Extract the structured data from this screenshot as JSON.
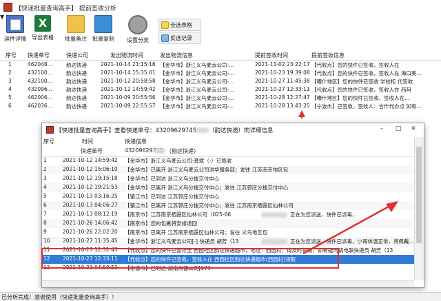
{
  "window": {
    "title": "【快递批量查询高手】 提前签收分析"
  },
  "toolbar": {
    "buttons": [
      {
        "label": "运件详情",
        "icon": "clipboard-icon"
      },
      {
        "label": "导出表格",
        "icon": "excel-icon"
      },
      {
        "label": "批量备注",
        "icon": "folder-icon"
      },
      {
        "label": "批量复制",
        "icon": "stack-icon"
      },
      {
        "label": "设置分类",
        "icon": "gear-icon"
      }
    ],
    "select_all": "全选表格",
    "invert_select": "反选记录"
  },
  "main_table": {
    "headers": [
      "序号",
      "快递单号",
      "快递公司",
      "发出物流时间",
      "发出物流信息",
      "提前签收时间",
      "提前签收信息"
    ],
    "rows": [
      [
        "1",
        "462048...",
        "韵达快递",
        "2021-10-14 21:15:16",
        "【金华市】浙江义乌麦云公司-...",
        "2021-11-02 23:22:17",
        "【代收点】您的快件已签收，签收人在"
      ],
      [
        "2",
        "432100...",
        "韵达快递",
        "2021-10-14 15:35:01",
        "【金华市】浙江义乌麦云公司-...",
        "2021-10-23 19:39:08",
        "【代收点】您的快件已签收，签收人在 海口美..."
      ],
      [
        "3",
        "432100...",
        "韵达快递",
        "2021-10-12 20:58:58",
        "【金华市】浙江义乌麦云公司-...",
        "2021-10-27 11:45:38",
        "【嘈什地区】您的快件已签收 学校柜 代签收"
      ],
      [
        "4",
        "432096...",
        "韵达快递",
        "2021-10-12 14:59:42",
        "【金华市】浙江义乌麦云公司-...",
        "2021-10-27 12:33:11",
        "【代收点】您的快件已签收，签收人在 西阿"
      ],
      [
        "5",
        "462006...",
        "韵达快递",
        "2021-10-09 20:55:56",
        "【金华市】浙江义乌麦云公司-...",
        "2021-10-28 12:27:47",
        "【嘈什地区】您的快件已签收，签收人在..."
      ],
      [
        "6",
        "462036...",
        "韵达快递",
        "2021-10-09 22:55:57",
        "【金华市】浙江义乌麦云公司-...",
        "2021-10-28 13:43:25",
        "【宁波市】已签收，签收人：合作代办点 如有..."
      ]
    ]
  },
  "detail_window": {
    "title": "【快递批量查询高手】查看快递单号：43209629745",
    "title_suffix": "（韵达快递）的详细信息",
    "headers": {
      "no": "序号",
      "time": "时间",
      "info": "快递信息"
    },
    "subheader": {
      "label": "快递单号",
      "value": "43209629741",
      "company": "（韵达快递）"
    },
    "rows": [
      {
        "no": "1",
        "time": "2021-10-12 14:59:42",
        "info": "【金华市】浙江义乌麦云公司-龚斌（-）已揽收"
      },
      {
        "no": "2",
        "time": "2021-10-12 15:06:10",
        "info": "【金华市】已离开 浙江义乌麦云公司洪华服务部；发往 江苏南京地区包"
      },
      {
        "no": "3",
        "time": "2021-10-12 19:15:18",
        "info": "【金华市】已到达 浙江义乌分拨交付中心"
      },
      {
        "no": "4",
        "time": "2021-10-12 19:21:53",
        "info": "【金华市】已离开 浙江义乌分拨交付中心；发往 江苏郭庄分拨交付中心"
      },
      {
        "no": "5",
        "time": "2021-10-13 03:16:25",
        "info": "【镇江市】已到达 江苏郭庄分拨交付中心"
      },
      {
        "no": "6",
        "time": "2021-10-13 04:06:27",
        "info": "【镇江市】已离开 江苏郭庄分拨交付中心；发往 江苏南京栖霞区仙林公司"
      },
      {
        "no": "7",
        "time": "2021-10-13 08:12:19",
        "info": "【南京市】江苏南京栖霞区仙林公司（025-66",
        "info2": "正在为您派送，快件已派毒，"
      },
      {
        "no": "8",
        "time": "2021-10-26 14:06:42",
        "info": "【南京市】您的包裹将安排退回"
      },
      {
        "no": "9",
        "time": "2021-10-26 22:02:20",
        "info": "【南京市】已离开 江苏南京栖霞区仙林公司；发往 义乌地区包"
      },
      {
        "no": "10",
        "time": "2021-10-27 11:35:45",
        "info": "【金华市】浙江义乌麦云公司[-] 快递员 胡芳（13",
        "info2": "正在为您派送。快件已派毒，小哥体温正常，将佩戴..."
      },
      {
        "no": "11",
        "time": "2021-10-27 12:32:43",
        "info": "【代收点】您的快件已暂存至 西园社区韵达快递超市，地址：西园村，请及时领取，如有疑问请电联快递员 胡芳（13"
      },
      {
        "no": "12",
        "time": "2021-10-27 12:33:11",
        "info": "【代收点】您的快件已签收，签收人在 西园社区韵达快递超市(西园村)领取"
      },
      {
        "no": "13",
        "time": "2021-10-31 04:59:53",
        "info": "【常德市】已到达 湖南常德公司[073"
      }
    ],
    "selected_row": "12"
  },
  "statusbar": {
    "text": "已分析完成！感谢使用（快递批量查询高手）！"
  },
  "colors": {
    "selection": "#2f7bd6",
    "annotation": "#e03030"
  }
}
